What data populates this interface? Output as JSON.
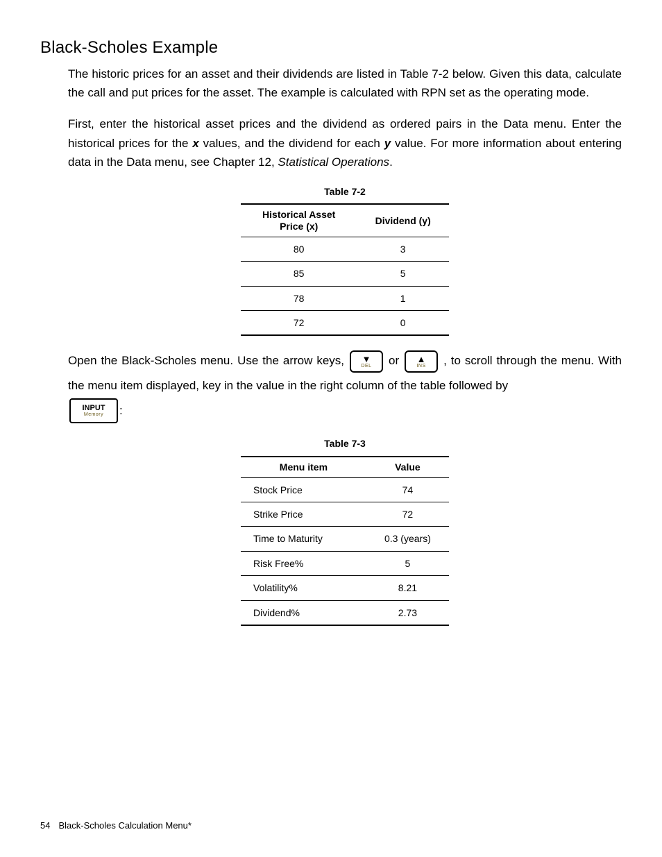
{
  "heading": "Black-Scholes Example",
  "para1_a": "The historic prices for an asset and their dividends are listed in Table 7-2 below. Given this data, calculate the call and put prices for the asset. The example is calculated with RPN set as the operating mode.",
  "para2_a": "First, enter the historical asset prices and the dividend as ordered pairs in the Data menu. Enter the historical prices for the ",
  "para2_var1": "x",
  "para2_b": " values, and the dividend for each ",
  "para2_var2": "y",
  "para2_c": " value. For more information about entering data in the Data menu, see Chapter 12, ",
  "para2_ital": "Statistical Operations",
  "para2_d": ".",
  "table72": {
    "caption": "Table 7-2",
    "head1a": "Historical Asset",
    "head1b": "Price (x)",
    "head2": "Dividend (y)",
    "rows": [
      {
        "c1": "80",
        "c2": "3"
      },
      {
        "c1": "85",
        "c2": "5"
      },
      {
        "c1": "78",
        "c2": "1"
      },
      {
        "c1": "72",
        "c2": "0"
      }
    ]
  },
  "para3_a": "Open the Black-Scholes menu. Use the arrow keys, ",
  "key_down_sub": "DEL",
  "para3_b": " or ",
  "key_up_sub": "INS",
  "para3_c": " , to scroll through the menu. With the menu item displayed, key in the value in the right column of the table followed by ",
  "key_input_main": "INPUT",
  "key_input_sub": "Memory",
  "para3_d": ":",
  "table73": {
    "caption": "Table 7-3",
    "head1": "Menu item",
    "head2": "Value",
    "rows": [
      {
        "c1": "Stock Price",
        "c2": "74"
      },
      {
        "c1": "Strike Price",
        "c2": "72"
      },
      {
        "c1": "Time to Maturity",
        "c2": "0.3 (years)"
      },
      {
        "c1": "Risk Free%",
        "c2": "5"
      },
      {
        "c1": "Volatility%",
        "c2": "8.21"
      },
      {
        "c1": "Dividend%",
        "c2": "2.73"
      }
    ]
  },
  "footer": {
    "page": "54",
    "title": "Black-Scholes Calculation Menu*"
  }
}
